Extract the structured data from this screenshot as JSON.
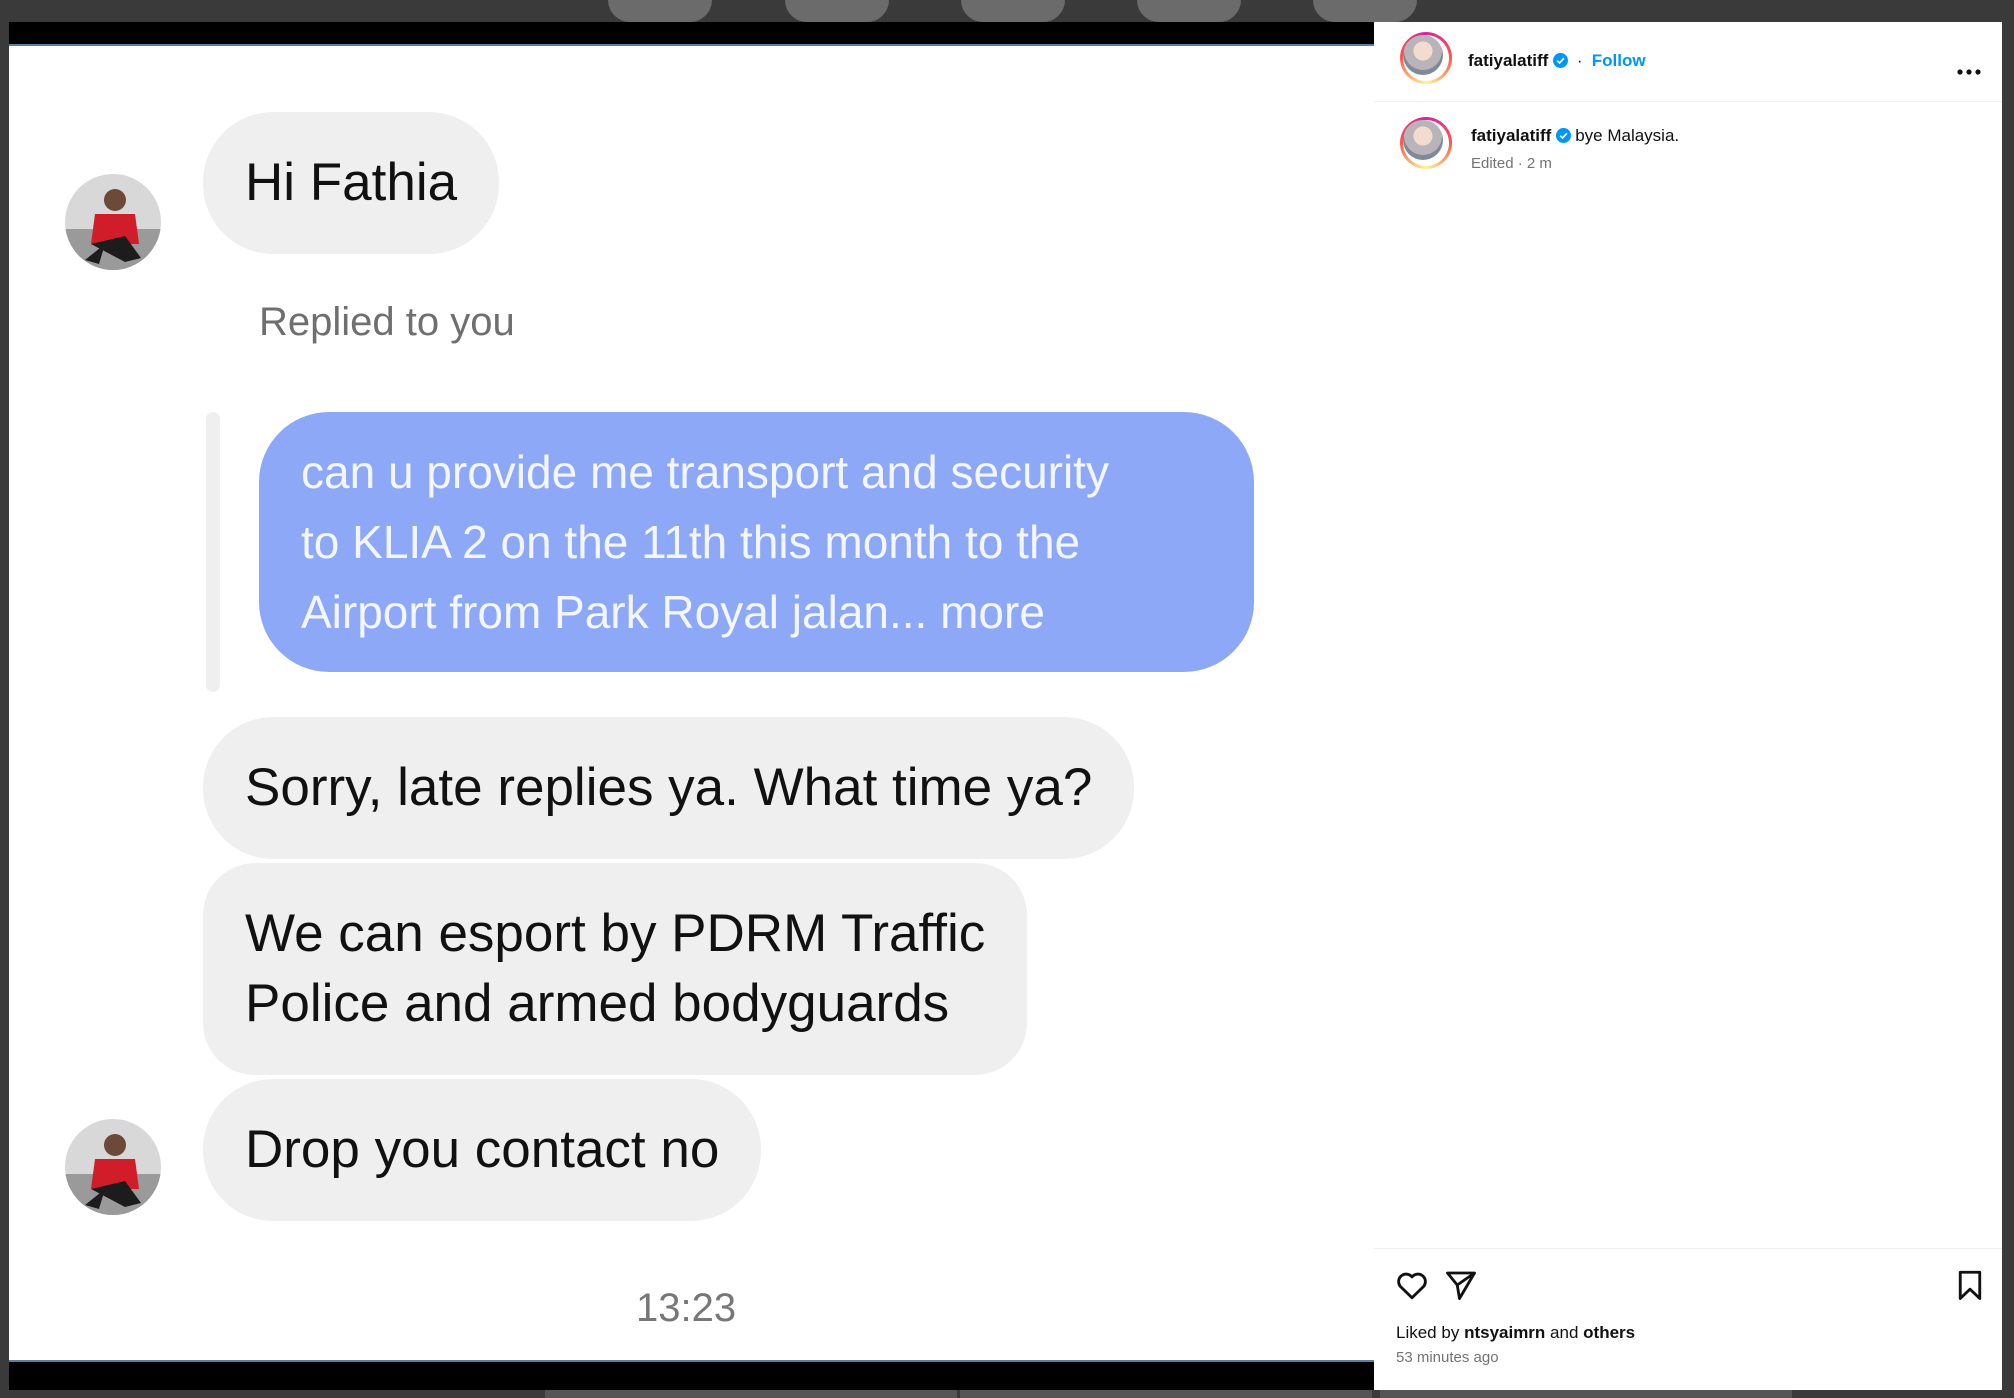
{
  "media": {
    "messages": [
      {
        "text": "Hi Fathia",
        "style": "incoming",
        "has_avatar": true
      },
      {
        "reply_label": "Replied to you"
      },
      {
        "text_lines": [
          "can u provide me transport and security",
          "to KLIA 2 on the 11th this month to the",
          "Airport from Park Royal jalan... more"
        ],
        "style": "outgoing"
      },
      {
        "text": "Sorry, late replies ya. What time ya?",
        "style": "incoming"
      },
      {
        "text_lines": [
          "We can esport by PDRM Traffic",
          "Police and armed bodyguards"
        ],
        "style": "incoming"
      },
      {
        "text": "Drop you contact no",
        "style": "incoming",
        "has_avatar": true
      }
    ],
    "timestamp": "13:23"
  },
  "post": {
    "username": "fatiyalatiff",
    "follow_label": "Follow",
    "caption_username": "fatiyalatiff",
    "caption_text": "bye Malaysia.",
    "caption_meta": "Edited · 2 m",
    "liked_by_prefix": "Liked by",
    "liked_by_user": "ntsyaimrn",
    "liked_by_and": "and",
    "liked_by_others": "others",
    "time_ago": "53 minutes ago"
  },
  "colors": {
    "accent": "#0095f6",
    "outgoing_bubble": "#8ea8f8",
    "incoming_bubble": "#efefef",
    "verified": "#0095f6"
  },
  "icons": [
    "more-options-icon",
    "heart-icon",
    "share-icon",
    "bookmark-icon",
    "verified-badge-icon"
  ]
}
